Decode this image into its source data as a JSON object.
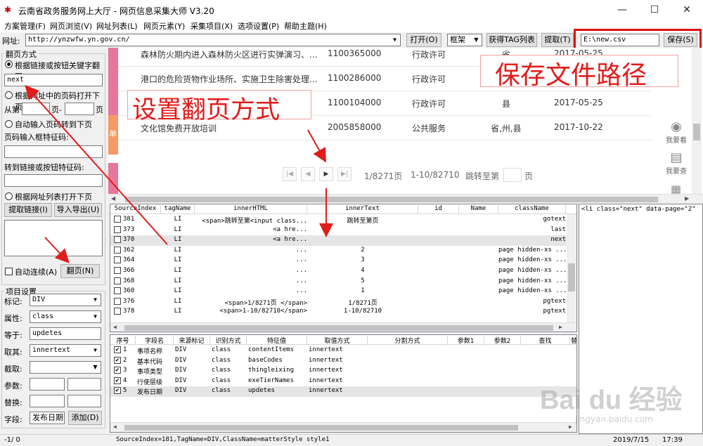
{
  "window": {
    "title": "云南省政务服务网上大厅 - 网页信息采集大师 V3.20",
    "minimize": "—",
    "maximize": "☐",
    "close": "✕"
  },
  "menu": [
    "方案管理(F)",
    "网页浏览(V)",
    "网址列表(L)",
    "网页元素(Y)",
    "采集项目(X)",
    "选项设置(P)",
    "帮助主题(H)"
  ],
  "address": {
    "label": "网址:",
    "url": "http://ynzwfw.yn.gov.cn/",
    "open_btn": "打开(O)",
    "frame_value": "框架",
    "get_tag_btn": "获得TAG列表",
    "extract_btn": "提取(T)",
    "save_path": "E:\\new.csv",
    "save_btn": "保存(S)"
  },
  "paging": {
    "group_title": "翻页方式",
    "opt1": "根据链接或按钮关键字翻页",
    "keyword": "next",
    "opt2": "根据网址中的页码打开下页",
    "from_label": "从第",
    "page_to": "页-",
    "page_end": "页",
    "opt3": "自动输入页码转到下页",
    "page_input_label": "页码输入框特征码:",
    "goto_label": "转到链接或按钮特征码:",
    "opt4": "根据网址列表打开下页",
    "extract_link_btn": "提取链接(I)",
    "import_export_btn": "导入导出(U)",
    "auto_continue": "自动连续(A)",
    "page_btn": "翻页(N)"
  },
  "item_settings": {
    "group_title": "项目设置",
    "tag_label": "标记:",
    "tag_value": "DIV",
    "attr_label": "属性:",
    "attr_value": "class",
    "equals_label": "等于:",
    "equals_value": "updetes",
    "take_label": "取其:",
    "take_value": "innertext",
    "cut_label": "截取:",
    "param_label": "参数:",
    "replace_label": "替换:",
    "field_label": "字段:",
    "field_value": "发布日期",
    "add_btn": "添加(D)"
  },
  "webpage": {
    "rows": [
      {
        "title": "森林防火期内进入森林防火区进行实弹演习、...",
        "code": "1100365000",
        "type": "行政许可",
        "level": "省",
        "date": "2017-05-25"
      },
      {
        "title": "港口的危险货物作业场所、实施卫生除害处理...",
        "code": "1100286000",
        "type": "行政许可",
        "level": "",
        "date": ""
      },
      {
        "title": "",
        "code": "1100104000",
        "type": "行政许可",
        "level": "县",
        "date": "2017-05-25"
      },
      {
        "title": "文化馆免费开放培训",
        "code": "2005858000",
        "type": "公共服务",
        "level": "省,州,县",
        "date": "2017-10-22"
      }
    ],
    "stripe_label": "单",
    "pager_info": "1/8271页",
    "pager_range": "1-10/82710",
    "pager_jump": "跳转至第",
    "pager_page": "页",
    "side_look": "我要看",
    "side_check": "我要查"
  },
  "tag_grid": {
    "headers": [
      "SourceIndex",
      "tagName",
      "innerHTML",
      "innerText",
      "id",
      "Name",
      "className"
    ],
    "rows": [
      {
        "idx": "381",
        "tag": "LI",
        "html": "<span>跳转至第<input class...",
        "text": "跳转至第页",
        "id": "",
        "name": "",
        "cls": "gotext"
      },
      {
        "idx": "373",
        "tag": "LI",
        "html": "<a hre...",
        "text": "",
        "id": "",
        "name": "",
        "cls": "last"
      },
      {
        "idx": "370",
        "tag": "LI",
        "html": "<a hre...",
        "text": "",
        "id": "",
        "name": "",
        "cls": "next"
      },
      {
        "idx": "362",
        "tag": "LI",
        "html": "...",
        "text": "2",
        "id": "",
        "name": "",
        "cls": "page hidden-xs ..."
      },
      {
        "idx": "364",
        "tag": "LI",
        "html": "...",
        "text": "3",
        "id": "",
        "name": "",
        "cls": "page hidden-xs ..."
      },
      {
        "idx": "366",
        "tag": "LI",
        "html": "...",
        "text": "4",
        "id": "",
        "name": "",
        "cls": "page hidden-xs ..."
      },
      {
        "idx": "368",
        "tag": "LI",
        "html": "...",
        "text": "5",
        "id": "",
        "name": "",
        "cls": "page hidden-xs ..."
      },
      {
        "idx": "360",
        "tag": "LI",
        "html": "...",
        "text": "1",
        "id": "",
        "name": "",
        "cls": "page hidden-xs ..."
      },
      {
        "idx": "376",
        "tag": "LI",
        "html": "<span>1/8271页 </span>",
        "text": "1/8271页",
        "id": "",
        "name": "",
        "cls": "pgtext"
      },
      {
        "idx": "378",
        "tag": "LI",
        "html": "<span>1-10/82710</span>",
        "text": "1-10/82710",
        "id": "",
        "name": "",
        "cls": "pgtext"
      }
    ]
  },
  "field_grid": {
    "headers": [
      "序号",
      "字段名",
      "来源标记",
      "识别方式",
      "特征值",
      "取值方式",
      "分割方式",
      "参数1",
      "参数2",
      "查找",
      "替"
    ],
    "rows": [
      {
        "no": "1",
        "name": "事项名称",
        "src": "DIV",
        "mode": "class",
        "feat": "contentItems",
        "val": "innertext"
      },
      {
        "no": "2",
        "name": "基本代码",
        "src": "DIV",
        "mode": "class",
        "feat": "baseCodes",
        "val": "innertext"
      },
      {
        "no": "3",
        "name": "事项类型",
        "src": "DIV",
        "mode": "class",
        "feat": "thingleixing",
        "val": "innertext"
      },
      {
        "no": "4",
        "name": "行使层级",
        "src": "DIV",
        "mode": "class",
        "feat": "exeTierNames",
        "val": "innertext"
      },
      {
        "no": "5",
        "name": "发布日期",
        "src": "DIV",
        "mode": "class",
        "feat": "updetes",
        "val": "innertext"
      }
    ]
  },
  "html_panel": "<li class=\"next\" data-page=\"2\"",
  "status": {
    "left": "-1/ 0",
    "info": "SourceIndex=181,TagName=DIV,ClassName=matterStyle style1",
    "date": "2019/7/15",
    "time": "17:39"
  },
  "annotations": {
    "save_path": "保存文件路径",
    "paging_mode": "设置翻页方式"
  },
  "watermark": {
    "text": "Bai du 经验",
    "sub": "jingyan.baidu.com"
  },
  "colors": {
    "annotation_red": "#e21b1b",
    "stripe_pink": "#e8769a",
    "stripe_orange": "#f59a62"
  }
}
